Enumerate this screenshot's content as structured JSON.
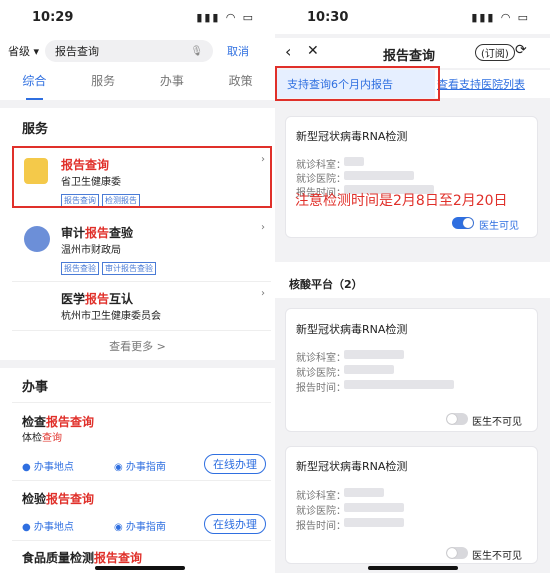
{
  "left": {
    "status_time": "10:29",
    "search": {
      "scope": "省级",
      "query": "报告查询",
      "cancel": "取消"
    },
    "tabs": [
      "综合",
      "服务",
      "办事",
      "政策"
    ],
    "service_section_title": "服务",
    "services": [
      {
        "title_highlight": "报告查询",
        "title_rest": "",
        "subtitle": "省卫生健康委",
        "tags": [
          "报告查询",
          "检测报告"
        ]
      },
      {
        "title_pre": "审计",
        "title_highlight": "报告",
        "title_rest": "查验",
        "subtitle": "温州市财政局",
        "tags": [
          "报告查验",
          "审计报告查验"
        ]
      },
      {
        "title_pre": "医学",
        "title_highlight": "报告",
        "title_rest": "互认",
        "subtitle": "杭州市卫生健康委员会",
        "tags": []
      }
    ],
    "see_more": "查看更多 >",
    "affairs_section_title": "办事",
    "affairs": [
      {
        "title_pre": "检查",
        "title_highlight": "报告查询",
        "sub_pre": "体检",
        "sub_highlight": "查询",
        "location": "办事地点",
        "guide": "办事指南",
        "online": "在线办理"
      },
      {
        "title_pre": "检验",
        "title_highlight": "报告查询",
        "location": "办事地点",
        "guide": "办事指南",
        "online": "在线办理"
      },
      {
        "title_pre": "食品质量检测",
        "title_highlight": "报告查询"
      }
    ]
  },
  "right": {
    "status_time": "10:30",
    "nav_title": "报告查询",
    "subscribe": "订阅",
    "info_left": "支持查询6个月内报告",
    "info_right": "查看支持医院列表",
    "annotation": "注意检测时间是2月8日至2月20日",
    "platform_title": "核酸平台（2）",
    "field_labels": [
      "就诊科室：",
      "就诊医院：",
      "报告时间："
    ],
    "cards": [
      {
        "title": "新型冠状病毒RNA检测",
        "visibility": "医生可见",
        "toggle_on": true
      },
      {
        "title": "新型冠状病毒RNA检测",
        "visibility": "医生不可见",
        "toggle_on": false
      },
      {
        "title": "新型冠状病毒RNA检测",
        "visibility": "医生不可见",
        "toggle_on": false
      }
    ]
  },
  "colors": {
    "accent": "#2f6fe0",
    "highlight": "#e0302a"
  }
}
